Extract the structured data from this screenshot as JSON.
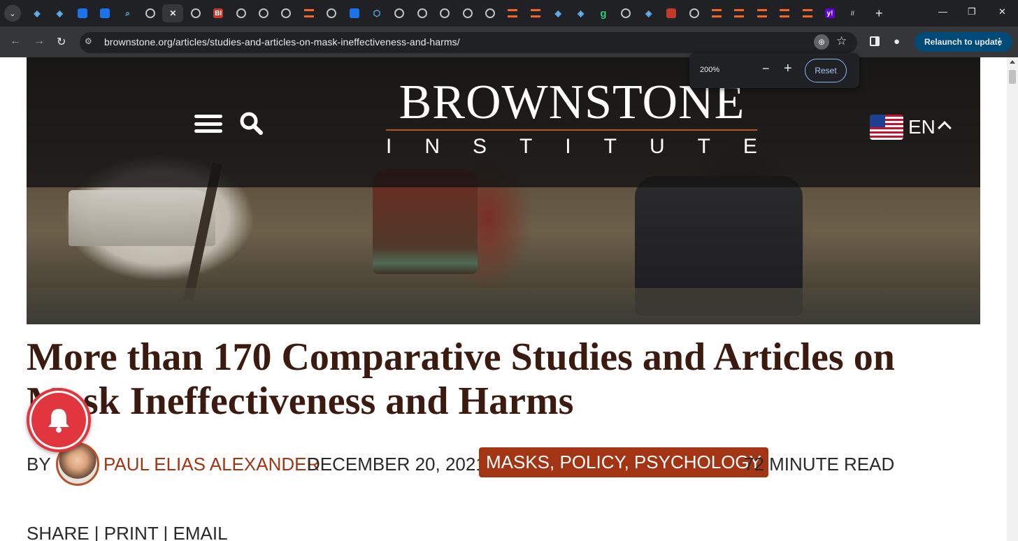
{
  "browser": {
    "url": "brownstone.org/articles/studies-and-articles-on-mask-ineffectiveness-and-harms/",
    "relaunch_label": "Relaunch to update",
    "zoom_popup": {
      "level": "200%",
      "reset_label": "Reset"
    },
    "tabs": [
      {
        "icon": "shield-icon"
      },
      {
        "icon": "shield-icon"
      },
      {
        "icon": "play-icon"
      },
      {
        "icon": "diamond-icon"
      },
      {
        "icon": "search-icon"
      },
      {
        "icon": "globe-icon"
      },
      {
        "icon": "close-icon",
        "active": true
      },
      {
        "icon": "globe-icon"
      },
      {
        "icon": "bi-icon",
        "text": "BI"
      },
      {
        "icon": "globe-icon"
      },
      {
        "icon": "globe-icon"
      },
      {
        "icon": "globe-icon"
      },
      {
        "icon": "bookmark-icon"
      },
      {
        "icon": "globe-icon"
      },
      {
        "icon": "gear-icon"
      },
      {
        "icon": "shield-outline-icon"
      },
      {
        "icon": "globe-icon"
      },
      {
        "icon": "globe-icon"
      },
      {
        "icon": "globe-icon"
      },
      {
        "icon": "globe-icon"
      },
      {
        "icon": "globe-icon"
      },
      {
        "icon": "bookmark-icon"
      },
      {
        "icon": "bookmark-icon"
      },
      {
        "icon": "shield-icon"
      },
      {
        "icon": "shield-icon"
      },
      {
        "icon": "grammarly-icon",
        "text": "g"
      },
      {
        "icon": "globe-icon"
      },
      {
        "icon": "shield-icon"
      },
      {
        "icon": "mic-icon"
      },
      {
        "icon": "globe-icon"
      },
      {
        "icon": "bookmark-icon"
      },
      {
        "icon": "bookmark-icon"
      },
      {
        "icon": "bookmark-icon"
      },
      {
        "icon": "bookmark-icon"
      },
      {
        "icon": "bookmark-icon"
      },
      {
        "icon": "yahoo-icon",
        "text": "y!"
      },
      {
        "icon": "slash-icon",
        "text": "//"
      }
    ]
  },
  "site": {
    "logo_main": "BROWNSTONE",
    "logo_sub": [
      "I",
      "N",
      "S",
      "T",
      "I",
      "T",
      "U",
      "T",
      "E"
    ],
    "language": "EN",
    "accent_color": "#a33414"
  },
  "article": {
    "title": "More than 170 Comparative Studies and Articles on Mask Ineffectiveness and Harms",
    "by_prefix": "BY",
    "author": "PAUL ELIAS ALEXANDER",
    "date": "DECEMBER 20, 2021",
    "tags": "MASKS, POLICY, PSYCHOLOGY",
    "read_time": "72 MINUTE READ",
    "share": [
      "SHARE",
      "PRINT",
      "EMAIL"
    ]
  }
}
